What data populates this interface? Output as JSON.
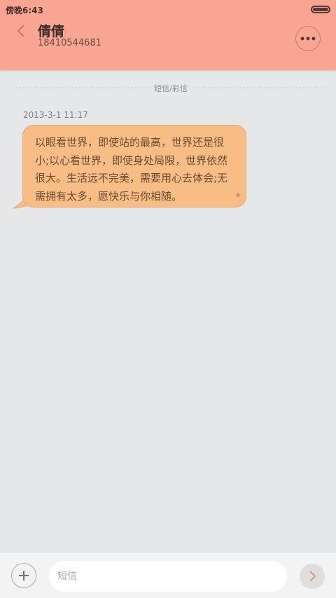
{
  "status_bar": {
    "time": "傍晚6:43"
  },
  "header": {
    "contact_name": "倩倩",
    "contact_number": "18410544681"
  },
  "conversation": {
    "divider_label": "短信/彩信",
    "messages": [
      {
        "timestamp": "2013-3-1 11:17",
        "text": "以眼看世界，即使站的最高，世界还是很小;以心看世界，即使身处局限，世界依然很大。生活远不完美，需要用心去体会;无需拥有太多，愿快乐与你相随。",
        "starred": true
      }
    ]
  },
  "compose": {
    "placeholder": "短信"
  },
  "colors": {
    "header_bg": "#f9a593",
    "bubble_bg": "#f7bd85",
    "page_bg": "#e6e7e9"
  },
  "icons": [
    "back-arrow-icon",
    "more-dots-icon",
    "star-icon",
    "plus-icon",
    "send-chevron-icon",
    "battery-icon"
  ]
}
